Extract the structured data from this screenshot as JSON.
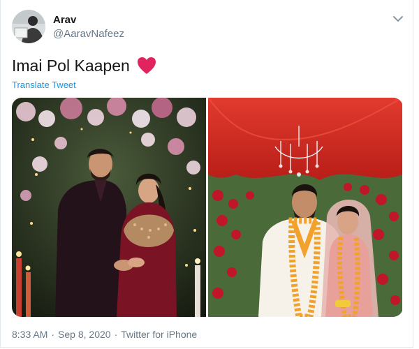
{
  "user": {
    "display_name": "Arav",
    "handle": "@AaravNafeez"
  },
  "tweet": {
    "text": "Imai Pol Kaapen",
    "emoji": "red-heart",
    "translate_label": "Translate Tweet"
  },
  "media": {
    "photos": [
      {
        "name": "engagement-photo",
        "description_icon": "photo"
      },
      {
        "name": "wedding-photo",
        "description_icon": "photo"
      }
    ]
  },
  "meta": {
    "time": "8:33 AM",
    "date": "Sep 8, 2020",
    "source": "Twitter for iPhone"
  },
  "colors": {
    "link": "#1b95e0",
    "heart": "#e0245e",
    "muted": "#657786"
  }
}
